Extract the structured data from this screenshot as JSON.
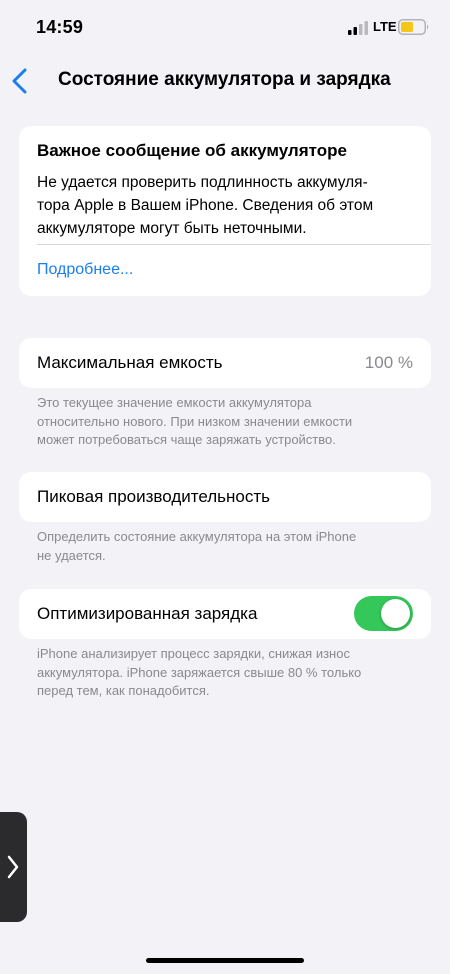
{
  "status_bar": {
    "time": "14:59",
    "network": "LTE",
    "icons": [
      "signal-icon",
      "battery-icon"
    ]
  },
  "nav": {
    "back_icon": "chevron-left-icon",
    "title": "Состояние аккумулятора и зарядка"
  },
  "message": {
    "title": "Важное сообщение об аккумуляторе",
    "body_lines": [
      "Не удается проверить подлинность аккумуля-",
      "тора Apple в Вашем iPhone. Сведения об этом",
      "аккумуляторе могут быть неточными."
    ],
    "link": "Подробнее..."
  },
  "capacity": {
    "label": "Максимальная емкость",
    "value": "100 %",
    "footnote_lines": [
      "Это текущее значение емкости аккумулятора",
      "относительно нового. При низком значении емкости",
      "может потребоваться чаще заряжать устройство."
    ]
  },
  "peak": {
    "label": "Пиковая производительность",
    "footnote_lines": [
      "Определить состояние аккумулятора на этом iPhone",
      "не удается."
    ]
  },
  "optimized": {
    "label": "Оптимизированная зарядка",
    "enabled": true,
    "footnote_lines": [
      "iPhone анализирует процесс зарядки, снижая износ",
      "аккумулятора. iPhone заряжается свыше 80 % только",
      "перед тем, как понадобится."
    ]
  },
  "colors": {
    "background": "#f2f2f7",
    "link": "#1a7df1",
    "toggle_on": "#34c759",
    "battery_fill": "#f5c518",
    "secondary_text": "#8a8a8e"
  }
}
